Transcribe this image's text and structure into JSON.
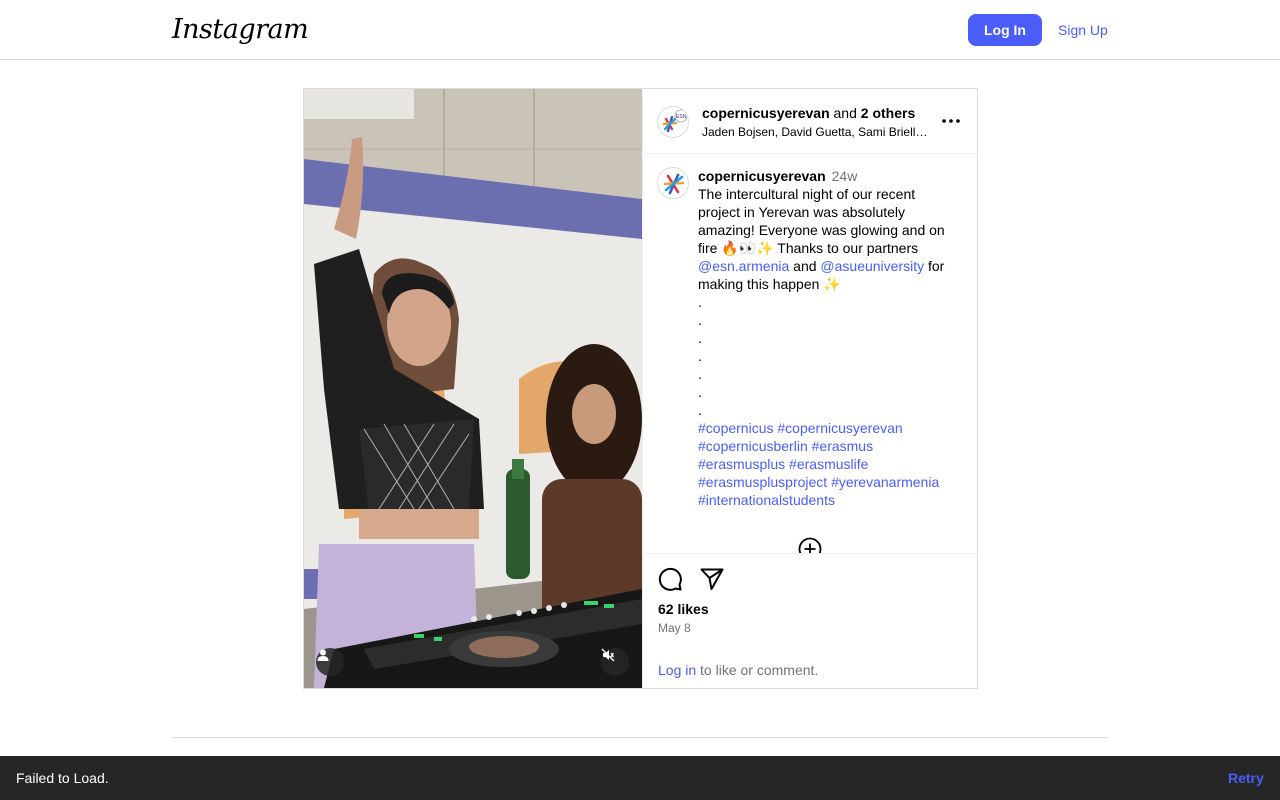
{
  "header": {
    "logo_text": "Instagram",
    "login_label": "Log In",
    "signup_label": "Sign Up"
  },
  "post": {
    "header": {
      "username": "copernicusyerevan",
      "and_text": "and",
      "others_text": "2 others",
      "collaborators": "Jaden Bojsen, David Guetta, Sami Briell…"
    },
    "caption": {
      "username": "copernicusyerevan",
      "time": "24w",
      "text_part1": "The intercultural night of our recent project in Yerevan was absolutely amazing! Everyone was glowing and on fire 🔥👀✨ Thanks to our partners ",
      "mention1": "@esn.armenia",
      "text_part2": " and ",
      "mention2": "@asueuniversity",
      "text_part3": " for making this happen ✨",
      "dots": [
        ".",
        ".",
        ".",
        ".",
        ".",
        ".",
        "."
      ],
      "hashtags": [
        "#copernicus",
        "#copernicusyerevan",
        "#copernicusberlin",
        "#erasmus",
        "#erasmusplus",
        "#erasmuslife",
        "#erasmusplusproject",
        "#yerevanarmenia",
        "#internationalstudents"
      ]
    },
    "likes": "62 likes",
    "date": "May 8",
    "login_link": "Log in",
    "login_suffix": " to like or comment.",
    "icons": {
      "more": "more-options-icon",
      "comment": "comment-icon",
      "share": "share-icon",
      "load_more": "plus-circle-icon",
      "tagged": "person-icon",
      "mute": "muted-speaker-icon"
    }
  },
  "snackbar": {
    "message": "Failed to Load.",
    "retry_label": "Retry"
  },
  "colors": {
    "accent": "#4a5df9",
    "snackbar_bg": "#262626",
    "border": "#dbdbdb",
    "muted_text": "#737373"
  }
}
